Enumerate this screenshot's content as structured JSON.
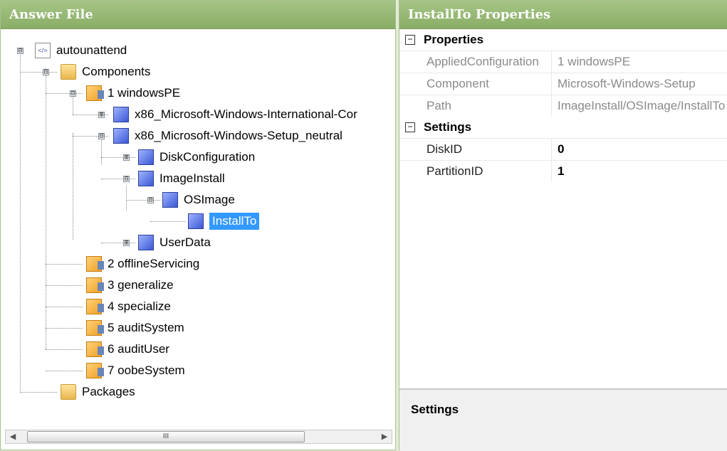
{
  "left_pane": {
    "title": "Answer File",
    "tree": {
      "root": "autounattend",
      "components": "Components",
      "pass1": "1 windowsPE",
      "intl": "x86_Microsoft-Windows-International-Cor",
      "setup": "x86_Microsoft-Windows-Setup_neutral",
      "disk": "DiskConfiguration",
      "imageinstall": "ImageInstall",
      "osimage": "OSImage",
      "installto": "InstallTo",
      "userdata": "UserData",
      "pass2": "2 offlineServicing",
      "pass3": "3 generalize",
      "pass4": "4 specialize",
      "pass5": "5 auditSystem",
      "pass6": "6 auditUser",
      "pass7": "7 oobeSystem",
      "packages": "Packages"
    },
    "scrollbar": {
      "thumb_glyph": "III"
    }
  },
  "right_pane": {
    "title": "InstallTo Properties",
    "properties_header": "Properties",
    "properties": [
      {
        "key": "AppliedConfiguration",
        "value": "1 windowsPE"
      },
      {
        "key": "Component",
        "value": "Microsoft-Windows-Setup"
      },
      {
        "key": "Path",
        "value": "ImageInstall/OSImage/InstallTo"
      }
    ],
    "settings_header": "Settings",
    "settings": [
      {
        "key": "DiskID",
        "value": "0"
      },
      {
        "key": "PartitionID",
        "value": "1"
      }
    ],
    "description_title": "Settings"
  },
  "icons": {
    "expanded": "⊟",
    "collapsed": "⊞"
  }
}
